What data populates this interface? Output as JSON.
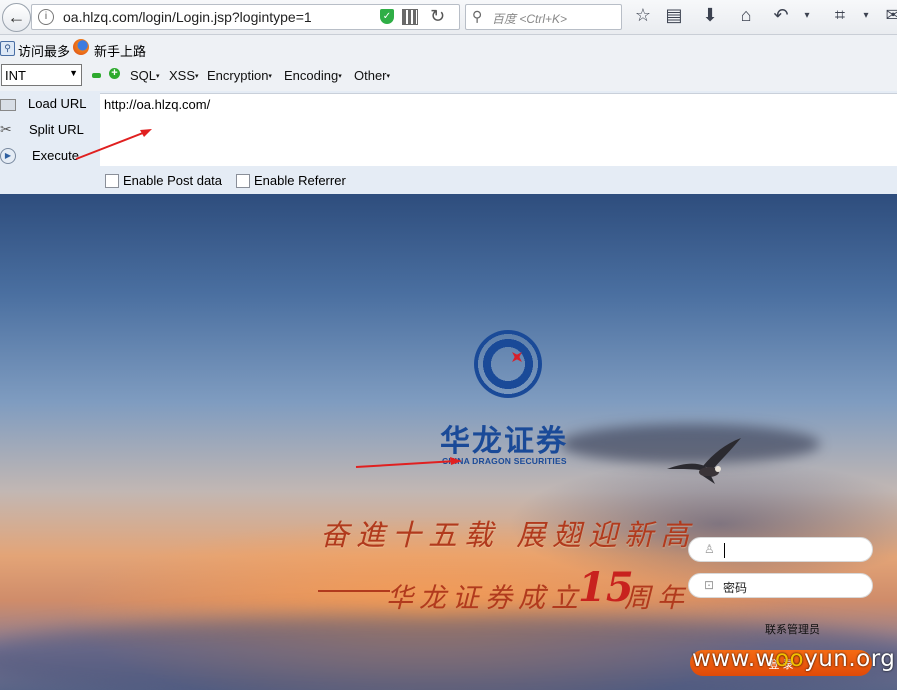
{
  "browser": {
    "url": "oa.hlzq.com/login/Login.jsp?logintype=1",
    "search_placeholder": "百度 <Ctrl+K>"
  },
  "bookmarks": [
    {
      "label": "访问最多",
      "icon": "bookmark-folder-icon"
    },
    {
      "label": "新手上路",
      "icon": "firefox-icon"
    }
  ],
  "hackbar": {
    "select_value": "INT",
    "menus": [
      "SQL",
      "XSS",
      "Encryption",
      "Encoding",
      "Other"
    ],
    "actions": [
      "Load URL",
      "Split URL",
      "Execute"
    ],
    "url_value": "http://oa.hlzq.com/",
    "checkboxes": [
      "Enable Post data",
      "Enable Referrer"
    ]
  },
  "page": {
    "brand_cn": "华龙证券",
    "brand_en": "CHINA DRAGON SECURITIES",
    "slogan_line1": "奋進十五载 展翅迎新高",
    "slogan_line2_a": "华龙证券成立",
    "slogan_line2_num": "15",
    "slogan_line2_b": "周年",
    "password_placeholder": "密码",
    "contact_admin": "联系管理员",
    "login_button": "登 录",
    "watermark": "www.wooyun.org"
  },
  "colors": {
    "brand_blue": "#1a4a98",
    "slogan_red": "#b13a1d",
    "login_orange": "#e04a08",
    "annotation_red": "#e02020"
  }
}
